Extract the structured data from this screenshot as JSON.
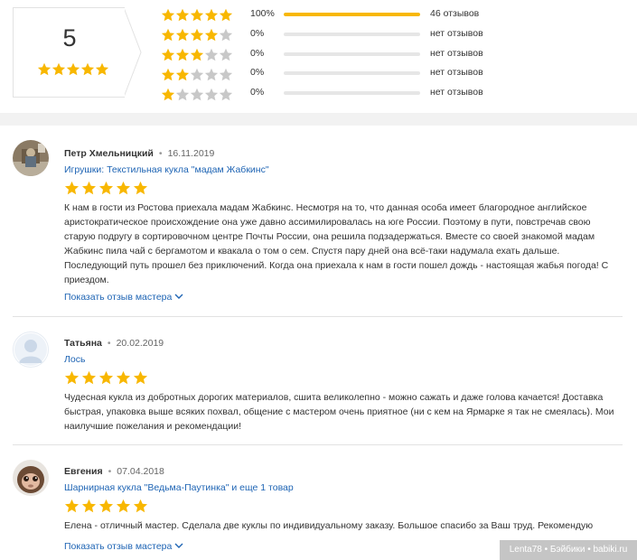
{
  "summary": {
    "average": "5",
    "average_stars": 5,
    "rows": [
      {
        "stars": 5,
        "percent": "100%",
        "fill": 1.0,
        "count": "46 отзывов"
      },
      {
        "stars": 4,
        "percent": "0%",
        "fill": 0,
        "count": "нет отзывов"
      },
      {
        "stars": 3,
        "percent": "0%",
        "fill": 0,
        "count": "нет отзывов"
      },
      {
        "stars": 2,
        "percent": "0%",
        "fill": 0,
        "count": "нет отзывов"
      },
      {
        "stars": 1,
        "percent": "0%",
        "fill": 0,
        "count": "нет отзывов"
      }
    ]
  },
  "colors": {
    "star_filled": "#f8b700",
    "star_empty": "#c8c8c8",
    "link": "#1e64b4",
    "bar_fill": "#f8b700",
    "bar_bg": "#e6e6e6"
  },
  "reviews": [
    {
      "author": "Петр Хмельницкий",
      "separator": "•",
      "date": "16.11.2019",
      "product": "Игрушки: Текстильная кукла \"мадам Жабкинс\"",
      "rating": 5,
      "text": "К нам в гости из Ростова приехала мадам Жабкинс. Несмотря на то, что данная особа имеет благородное английское аристократическое происхождение она уже давно ассимилировалась на юге России. Поэтому в пути, повстречав свою старую подругу в сортировочном центре Почты России, она решила подзадержаться. Вместе со своей знакомой мадам Жабкинс пила чай с бергамотом и квакала о том о сем. Спустя пару дней она всё-таки надумала ехать дальше. Последующий путь прошел без приключений. Когда она приехала к нам в гости пошел дождь - настоящая жабья погода! С приездом.",
      "show_master": "Показать отзыв мастера",
      "avatar": "photo-avatar"
    },
    {
      "author": "Татьяна",
      "separator": "•",
      "date": "20.02.2019",
      "product": "Лось",
      "rating": 5,
      "text": "Чудесная кукла из добротных дорогих материалов, сшита великолепно - можно сажать и даже голова качается! Доставка быстрая, упаковка выше всяких похвал, общение с мастером очень приятное (ни с кем на Ярмарке я так не смеялась). Мои наилучшие пожелания и рекомендации!",
      "avatar": "default-avatar"
    },
    {
      "author": "Евгения",
      "separator": "•",
      "date": "07.04.2018",
      "product": "Шарнирная кукла \"Ведьма-Паутинка\" и еще 1 товар",
      "rating": 5,
      "text": "Елена - отличный мастер. Сделала две куклы по индивидуальному заказу. Большое спасибо за Ваш труд. Рекомендую",
      "show_master": "Показать отзыв мастера",
      "avatar": "monkey-photo-avatar"
    }
  ],
  "watermark": "Lenta78 • Бэйбики • babiki.ru"
}
